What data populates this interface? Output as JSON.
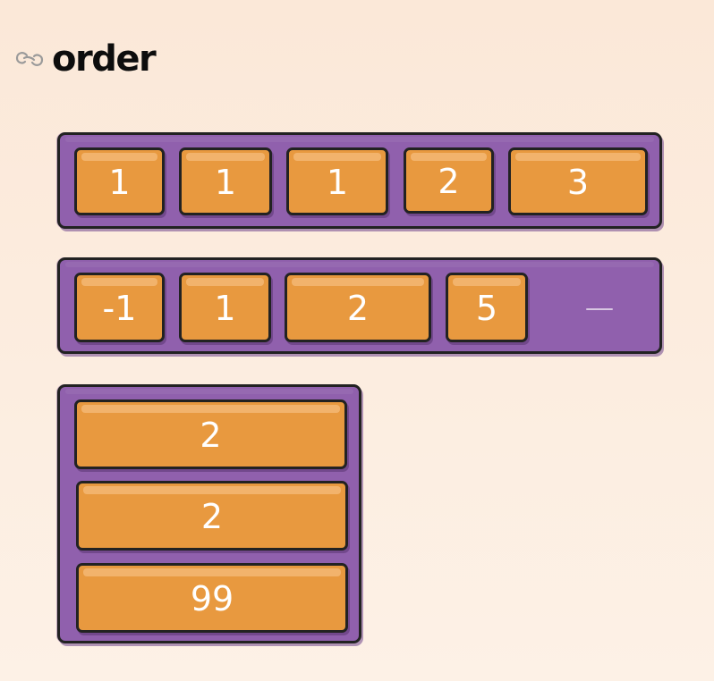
{
  "header": {
    "title": "order",
    "link_icon": "link-icon"
  },
  "colors": {
    "container": "#9060ad",
    "item": "#e8993f",
    "item_text": "#ffffff",
    "outline": "#222222",
    "background": "#fbe8d8"
  },
  "example_1": {
    "direction": "row",
    "items": [
      "1",
      "1",
      "1",
      "2",
      "3"
    ]
  },
  "example_2": {
    "direction": "row",
    "items": [
      "-1",
      "1",
      "2",
      "5"
    ]
  },
  "example_3": {
    "direction": "column",
    "items": [
      "2",
      "2",
      "99"
    ]
  }
}
